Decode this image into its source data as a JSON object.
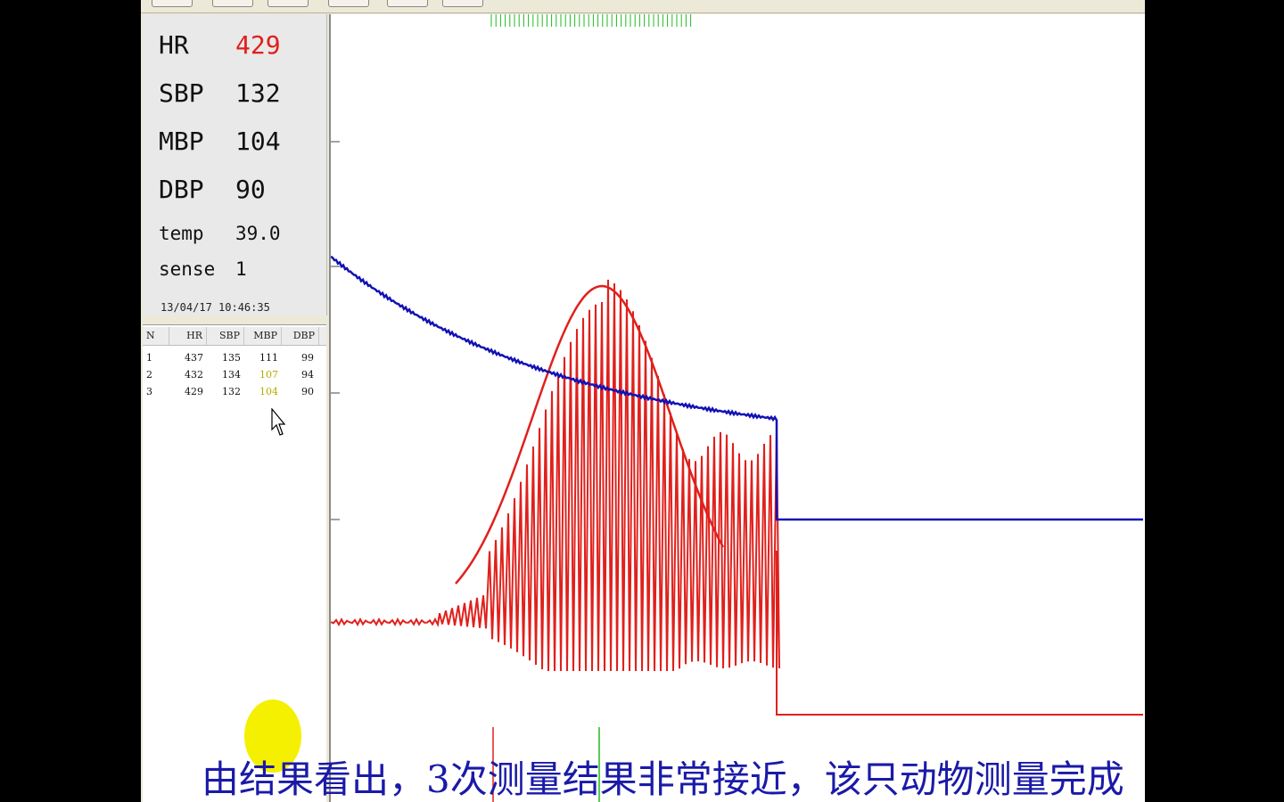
{
  "readout": {
    "hr_label": "HR",
    "hr_value": "429",
    "sbp_label": "SBP",
    "sbp_value": "132",
    "mbp_label": "MBP",
    "mbp_value": "104",
    "dbp_label": "DBP",
    "dbp_value": "90",
    "temp_label": "temp",
    "temp_value": "39.0",
    "sense_label": "sense",
    "sense_value": "1",
    "datetime": "13/04/17  10:46:35"
  },
  "results_table": {
    "headers": [
      "N",
      "HR",
      "SBP",
      "MBP",
      "DBP"
    ],
    "rows": [
      [
        "1",
        "437",
        "135",
        "111",
        "99"
      ],
      [
        "2",
        "432",
        "134",
        "107",
        "94"
      ],
      [
        "3",
        "429",
        "132",
        "104",
        "90"
      ]
    ]
  },
  "colors": {
    "cuff_pressure": "#1212b4",
    "pulse_oscillation": "#e0201c",
    "envelope": "#e0201c",
    "markers_green": "#22bb22",
    "caption": "#1a1aa8",
    "highlight": "#f4f000"
  },
  "icons": {
    "pointer": "mouse-pointer-icon"
  },
  "caption": "由结果看出，3次测量结果非常接近，该只动物测量完成"
}
